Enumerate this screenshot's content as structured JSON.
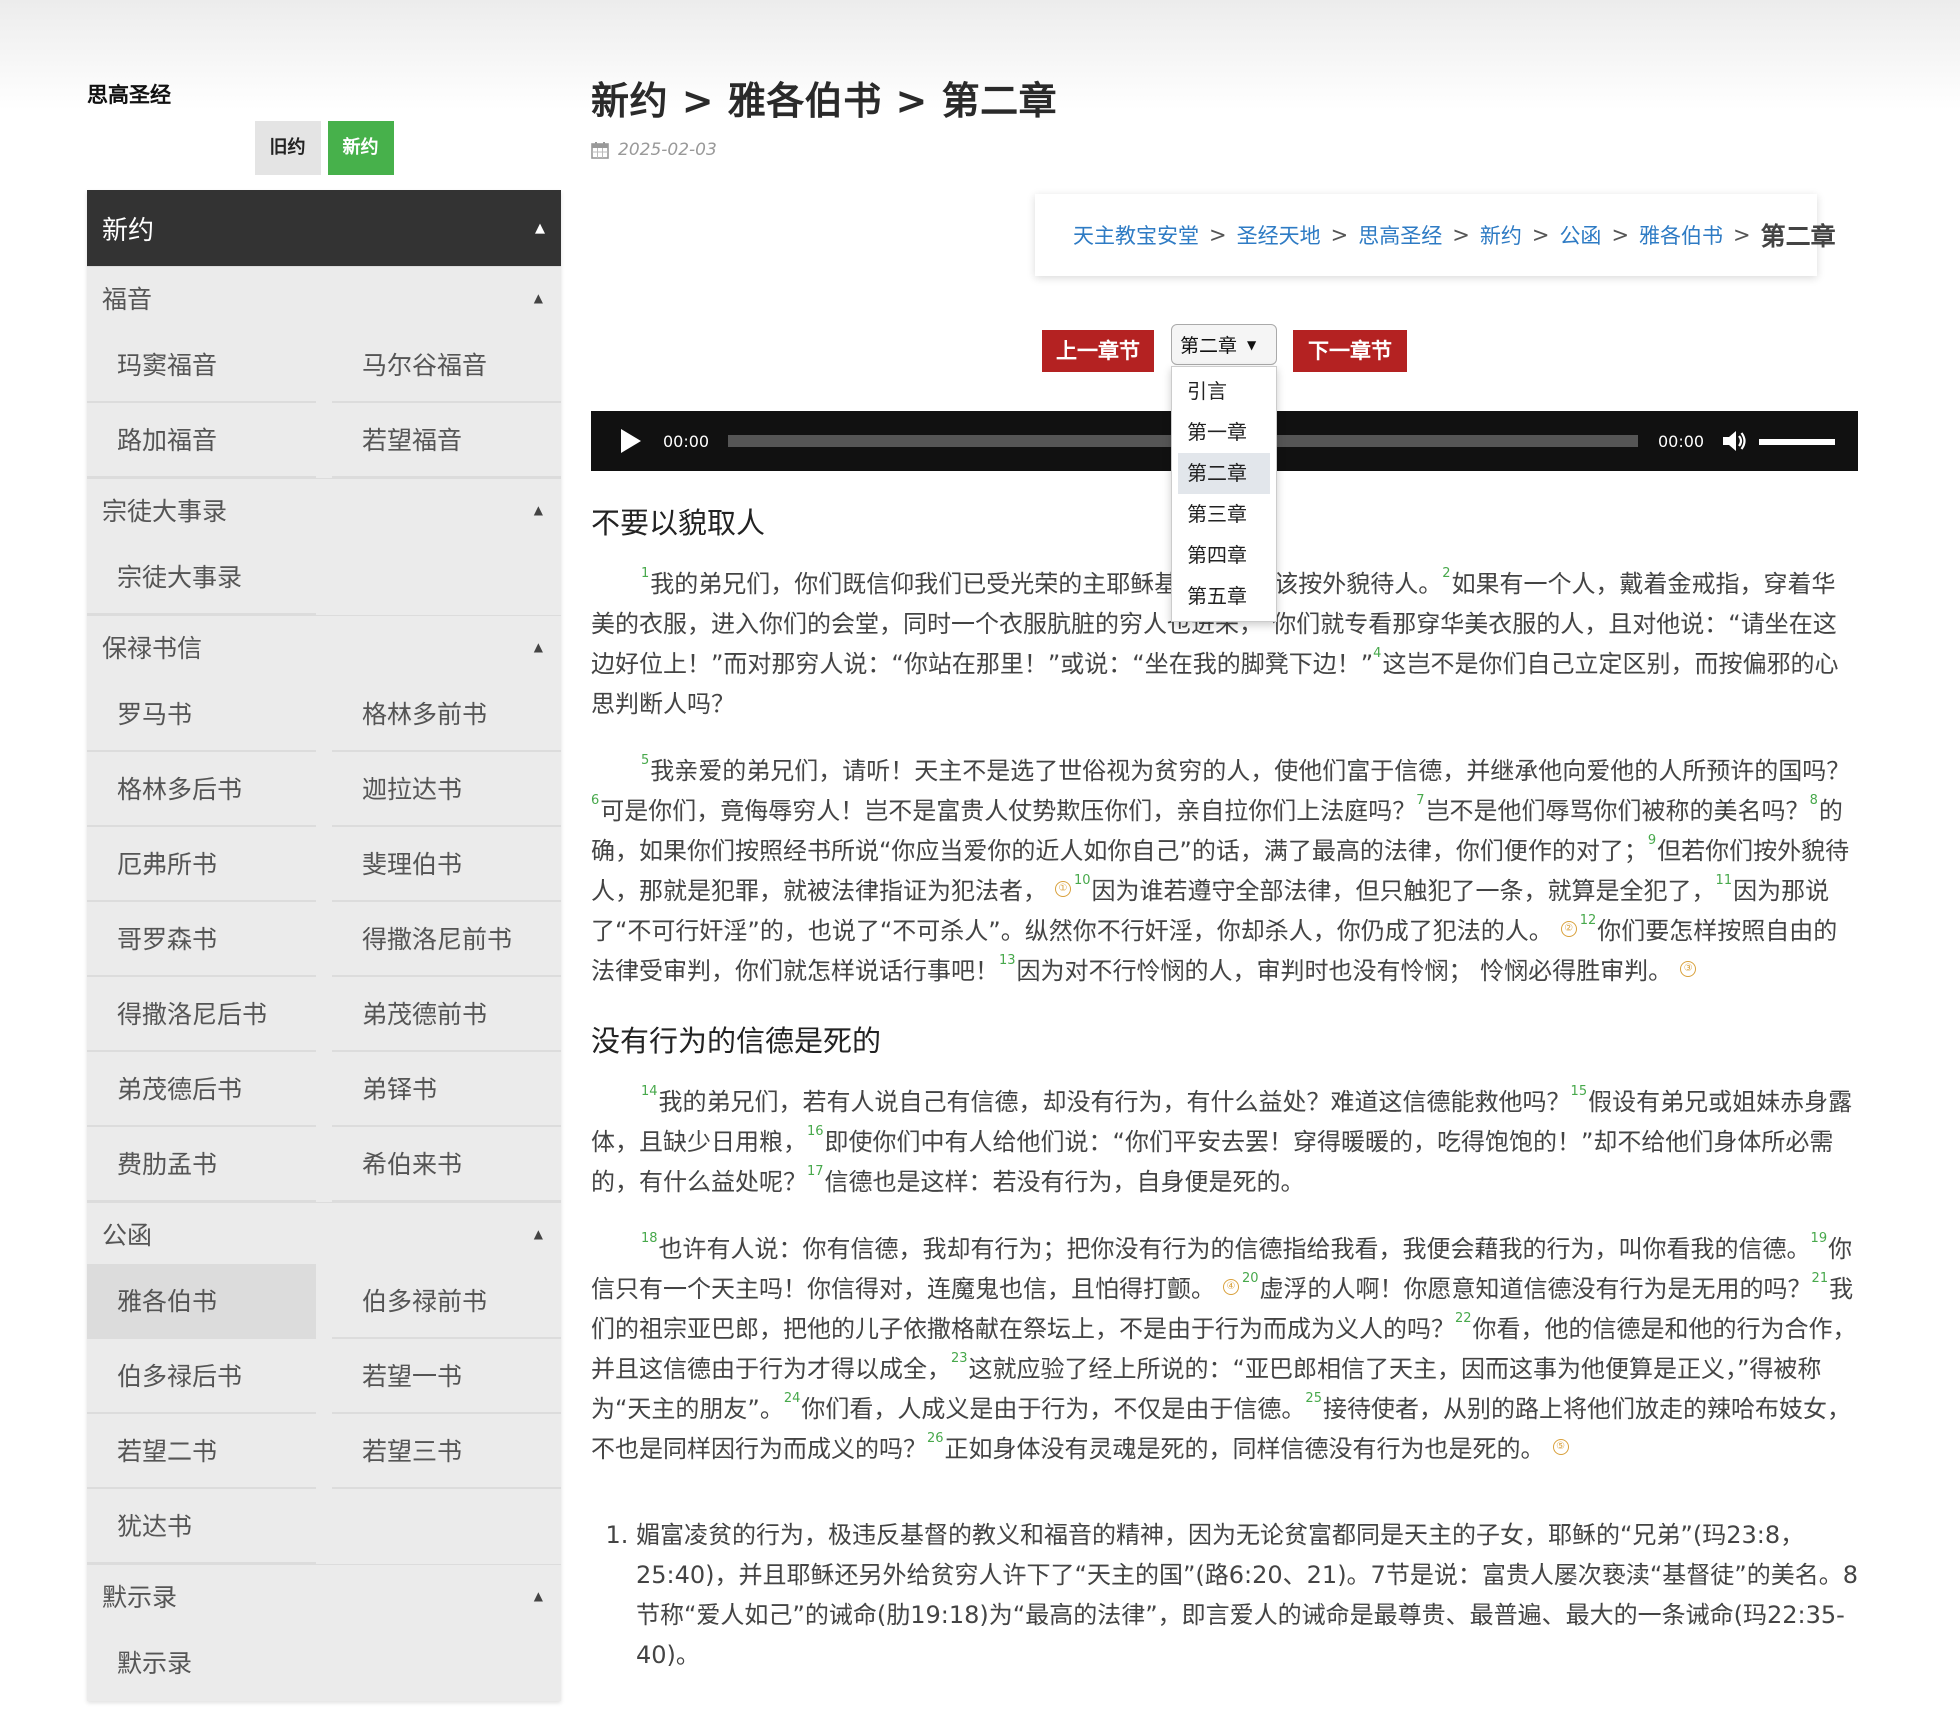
{
  "sidebar": {
    "site_title": "思高圣经",
    "testament_tabs": [
      "旧约",
      "新约"
    ],
    "menu_title": "新约",
    "sections": [
      {
        "name": "福音",
        "books": [
          "玛窦福音",
          "马尔谷福音",
          "路加福音",
          "若望福音"
        ]
      },
      {
        "name": "宗徒大事录",
        "books": [
          "宗徒大事录"
        ]
      },
      {
        "name": "保禄书信",
        "books": [
          "罗马书",
          "格林多前书",
          "格林多后书",
          "迦拉达书",
          "厄弗所书",
          "斐理伯书",
          "哥罗森书",
          "得撒洛尼前书",
          "得撒洛尼后书",
          "弟茂德前书",
          "弟茂德后书",
          "弟铎书",
          "费肋孟书",
          "希伯来书"
        ]
      },
      {
        "name": "公函",
        "books": [
          "雅各伯书",
          "伯多禄前书",
          "伯多禄后书",
          "若望一书",
          "若望二书",
          "若望三书",
          "犹达书"
        ],
        "active": "雅各伯书"
      },
      {
        "name": "默示录",
        "books": [
          "默示录"
        ]
      }
    ]
  },
  "header": {
    "title": "新约 > 雅各伯书 > 第二章",
    "date": "2025-02-03"
  },
  "breadcrumb": {
    "links": [
      "天主教宝安堂",
      "圣经天地",
      "思高圣经",
      "新约",
      "公函",
      "雅各伯书"
    ],
    "separator": ">",
    "current": "第二章"
  },
  "chapter_nav": {
    "prev_label": "上一章节",
    "next_label": "下一章节",
    "selected": "第二章",
    "options": [
      "引言",
      "第一章",
      "第二章",
      "第三章",
      "第四章",
      "第五章"
    ]
  },
  "audio": {
    "current_time": "00:00",
    "duration": "00:00",
    "progress": 0,
    "volume": 1.0
  },
  "content": {
    "sections": [
      {
        "heading": "不要以貌取人",
        "paragraphs": [
          [
            {
              "v": "1",
              "t": "我的弟兄们，你们既信仰我们已受光荣的主耶稣基督，就不该按外貌待人。"
            },
            {
              "v": "2",
              "t": "如果有一个人，戴着金戒指，穿着华美的衣服，进入你们的会堂，同时一个衣服肮脏的穷人也进来，"
            },
            {
              "v": "3",
              "t": "你们就专看那穿华美衣服的人，且对他说：“请坐在这边好位上！”而对那穷人说：“你站在那里！”或说：“坐在我的脚凳下边！”"
            },
            {
              "v": "4",
              "t": "这岂不是你们自己立定区别，而按偏邪的心思判断人吗？"
            }
          ],
          [
            {
              "v": "5",
              "t": "我亲爱的弟兄们，请听！天主不是选了世俗视为贫穷的人，使他们富于信德，并继承他向爱他的人所预许的国吗？"
            },
            {
              "v": "6",
              "t": "可是你们，竟侮辱穷人！岂不是富贵人仗势欺压你们，亲自拉你们上法庭吗？"
            },
            {
              "v": "7",
              "t": "岂不是他们辱骂你们被称的美名吗？"
            },
            {
              "v": "8",
              "t": "的确，如果你们按照经书所说“你应当爱你的近人如你自己”的话，满了最高的法律，你们便作的对了；"
            },
            {
              "v": "9",
              "t": "但若你们按外貌待人，那就是犯罪，就被法律指证为犯法者，",
              "fn": "①"
            },
            {
              "v": "10",
              "t": "因为谁若遵守全部法律，但只触犯了一条，就算是全犯了，"
            },
            {
              "v": "11",
              "t": "因为那说了“不可行奸淫”的，也说了“不可杀人”。纵然你不行奸淫，你却杀人，你仍成了犯法的人。",
              "fn": "②"
            },
            {
              "v": "12",
              "t": "你们要怎样按照自由的法律受审判，你们就怎样说话行事吧！"
            },
            {
              "v": "13",
              "t": "因为对不行怜悯的人，审判时也没有怜悯； 怜悯必得胜审判。",
              "fn": "③"
            }
          ]
        ]
      },
      {
        "heading": "没有行为的信德是死的",
        "paragraphs": [
          [
            {
              "v": "14",
              "t": "我的弟兄们，若有人说自己有信德，却没有行为，有什么益处？难道这信德能救他吗？"
            },
            {
              "v": "15",
              "t": "假设有弟兄或姐妹赤身露体，且缺少日用粮，"
            },
            {
              "v": "16",
              "t": "即使你们中有人给他们说：“你们平安去罢！穿得暖暖的，吃得饱饱的！”却不给他们身体所必需的，有什么益处呢？"
            },
            {
              "v": "17",
              "t": "信德也是这样：若没有行为，自身便是死的。"
            }
          ],
          [
            {
              "v": "18",
              "t": "也许有人说：你有信德，我却有行为；把你没有行为的信德指给我看，我便会藉我的行为，叫你看我的信德。"
            },
            {
              "v": "19",
              "t": "你信只有一个天主吗！你信得对，连魔鬼也信，且怕得打颤。",
              "fn": "④"
            },
            {
              "v": "20",
              "t": "虚浮的人啊！你愿意知道信德没有行为是无用的吗？"
            },
            {
              "v": "21",
              "t": "我们的祖宗亚巴郎，把他的儿子依撒格献在祭坛上，不是由于行为而成为义人的吗？"
            },
            {
              "v": "22",
              "t": "你看，他的信德是和他的行为合作，并且这信德由于行为才得以成全，"
            },
            {
              "v": "23",
              "t": "这就应验了经上所说的：“亚巴郎相信了天主，因而这事为他便算是正义，”得被称为“天主的朋友”。"
            },
            {
              "v": "24",
              "t": "你们看，人成义是由于行为，不仅是由于信德。"
            },
            {
              "v": "25",
              "t": "接待使者，从别的路上将他们放走的辣哈布妓女，不也是同样因行为而成义的吗？"
            },
            {
              "v": "26",
              "t": "正如身体没有灵魂是死的，同样信德没有行为也是死的。",
              "fn": "⑤"
            }
          ]
        ]
      }
    ],
    "footnotes": [
      "媚富凌贫的行为，极违反基督的教义和福音的精神，因为无论贫富都同是天主的子女，耶稣的“兄弟”(玛23:8，25:40)，并且耶稣还另外给贫穷人许下了“天主的国”(路6:20、21)。7节是说：富贵人屡次亵渎“基督徒”的美名。8节称“爱人如己”的诫命(肋19:18)为“最高的法律”，即言爱人的诫命是最尊贵、最普遍、最大的一条诫命(玛22:35-40)。"
    ]
  }
}
